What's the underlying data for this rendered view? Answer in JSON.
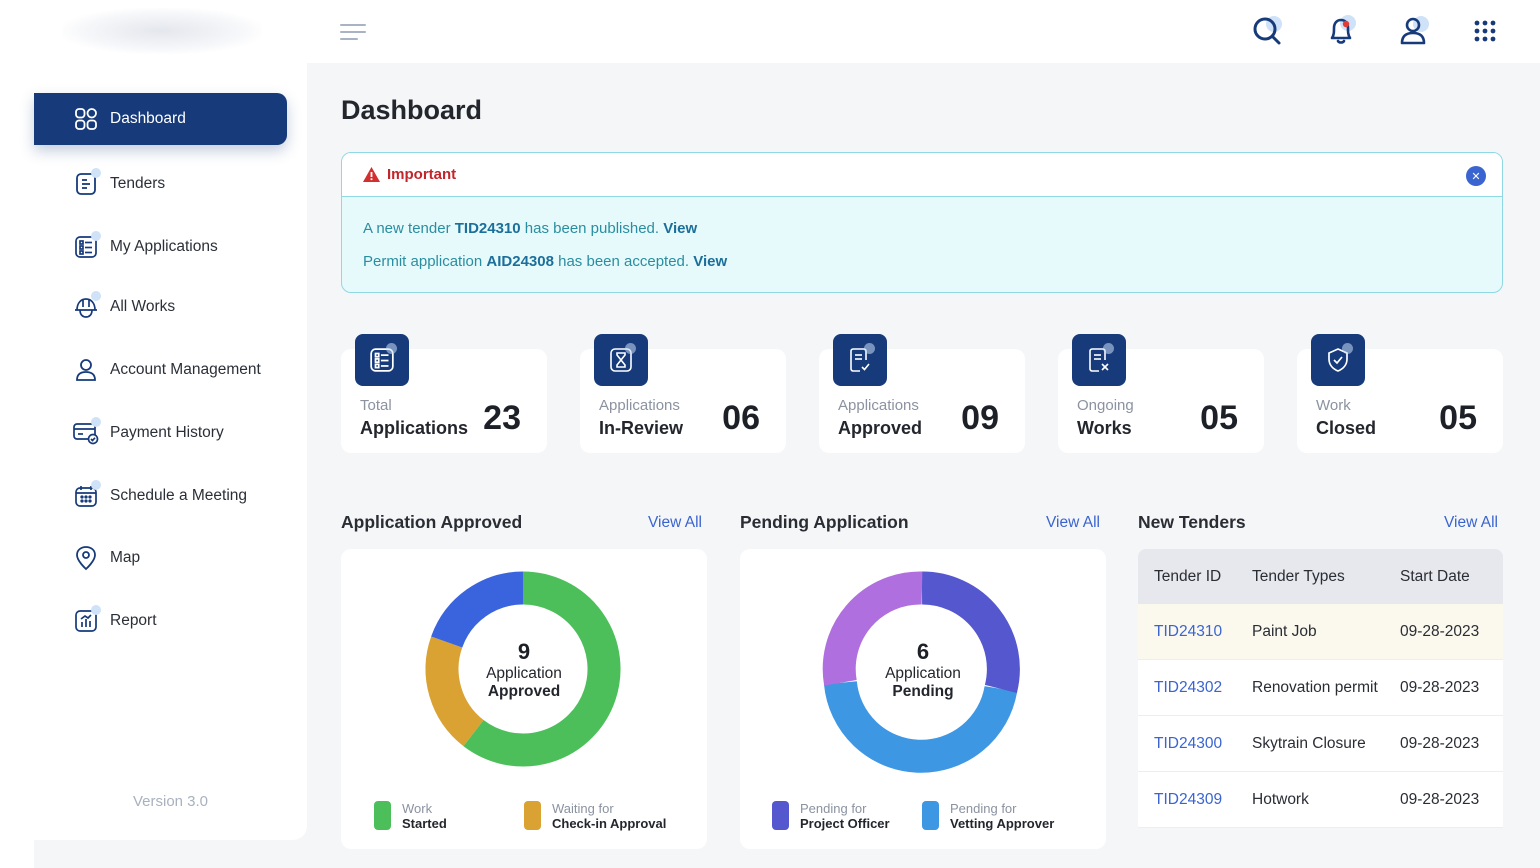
{
  "header": {
    "menu_icon": "hamburger-icon",
    "icons": [
      "search-icon",
      "bell-icon",
      "user-icon",
      "apps-grid-icon"
    ]
  },
  "sidebar": {
    "items": [
      {
        "label": "Dashboard",
        "icon": "grid-icon",
        "active": true
      },
      {
        "label": "Tenders",
        "icon": "document-icon"
      },
      {
        "label": "My Applications",
        "icon": "checklist-icon"
      },
      {
        "label": "All Works",
        "icon": "hardhat-icon"
      },
      {
        "label": "Account Management",
        "icon": "user-icon"
      },
      {
        "label": "Payment History",
        "icon": "payment-icon"
      },
      {
        "label": "Schedule a Meeting",
        "icon": "calendar-icon"
      },
      {
        "label": "Map",
        "icon": "map-pin-icon"
      },
      {
        "label": "Report",
        "icon": "report-icon"
      }
    ],
    "version": "Version 3.0"
  },
  "page": {
    "title": "Dashboard"
  },
  "alert": {
    "title": "Important",
    "line1": {
      "prefix": "A new tender ",
      "id": "TID24310",
      "suffix": " has been published. ",
      "link": "View"
    },
    "line2": {
      "prefix": "Permit application ",
      "id": "AID24308",
      "suffix": " has been accepted. ",
      "link": "View"
    }
  },
  "stats": [
    {
      "small": "Total",
      "big": "Applications",
      "value": "23",
      "icon": "checklist-icon"
    },
    {
      "small": "Applications",
      "big": "In-Review",
      "value": "06",
      "icon": "hourglass-icon"
    },
    {
      "small": "Applications",
      "big": "Approved",
      "value": "09",
      "icon": "doc-check-icon"
    },
    {
      "small": "Ongoing",
      "big": "Works",
      "value": "05",
      "icon": "doc-x-icon"
    },
    {
      "small": "Work",
      "big": "Closed",
      "value": "05",
      "icon": "shield-check-icon"
    }
  ],
  "approved": {
    "title": "Application Approved",
    "view_all": "View All",
    "center": {
      "num": "9",
      "l1": "Application",
      "l2": "Approved"
    },
    "legend": [
      {
        "t1": "Work",
        "t2": "Started",
        "color": "#4cbf5a"
      },
      {
        "t1": "Waiting for",
        "t2": "Check-in Approval",
        "color": "#d9a233"
      }
    ],
    "colors": {
      "green": "#4cbf5a",
      "gold": "#d9a233",
      "blue": "#3a64dd"
    }
  },
  "pending": {
    "title": "Pending Application",
    "view_all": "View All",
    "center": {
      "num": "6",
      "l1": "Application",
      "l2": "Pending"
    },
    "legend": [
      {
        "t1": "Pending for",
        "t2": "Project Officer",
        "color": "#5557cf"
      },
      {
        "t1": "Pending for",
        "t2": "Vetting Approver",
        "color": "#3e97e3"
      }
    ],
    "colors": {
      "indigo": "#5557cf",
      "sky": "#3e97e3",
      "purple": "#b06fde"
    }
  },
  "tenders": {
    "title": "New Tenders",
    "view_all": "View All",
    "headers": [
      "Tender ID",
      "Tender Types",
      "Start Date"
    ],
    "rows": [
      {
        "id": "TID24310",
        "type": "Paint Job",
        "date": "09-28-2023"
      },
      {
        "id": "TID24302",
        "type": "Renovation permit",
        "date": "09-28-2023"
      },
      {
        "id": "TID24300",
        "type": "Skytrain Closure",
        "date": "09-28-2023"
      },
      {
        "id": "TID24309",
        "type": "Hotwork",
        "date": "09-28-2023"
      }
    ]
  },
  "colors": {
    "brand": "#163a7a",
    "accent": "#3a64cf",
    "alert_bg": "#e6fafc",
    "alert_red": "#c0262c"
  }
}
